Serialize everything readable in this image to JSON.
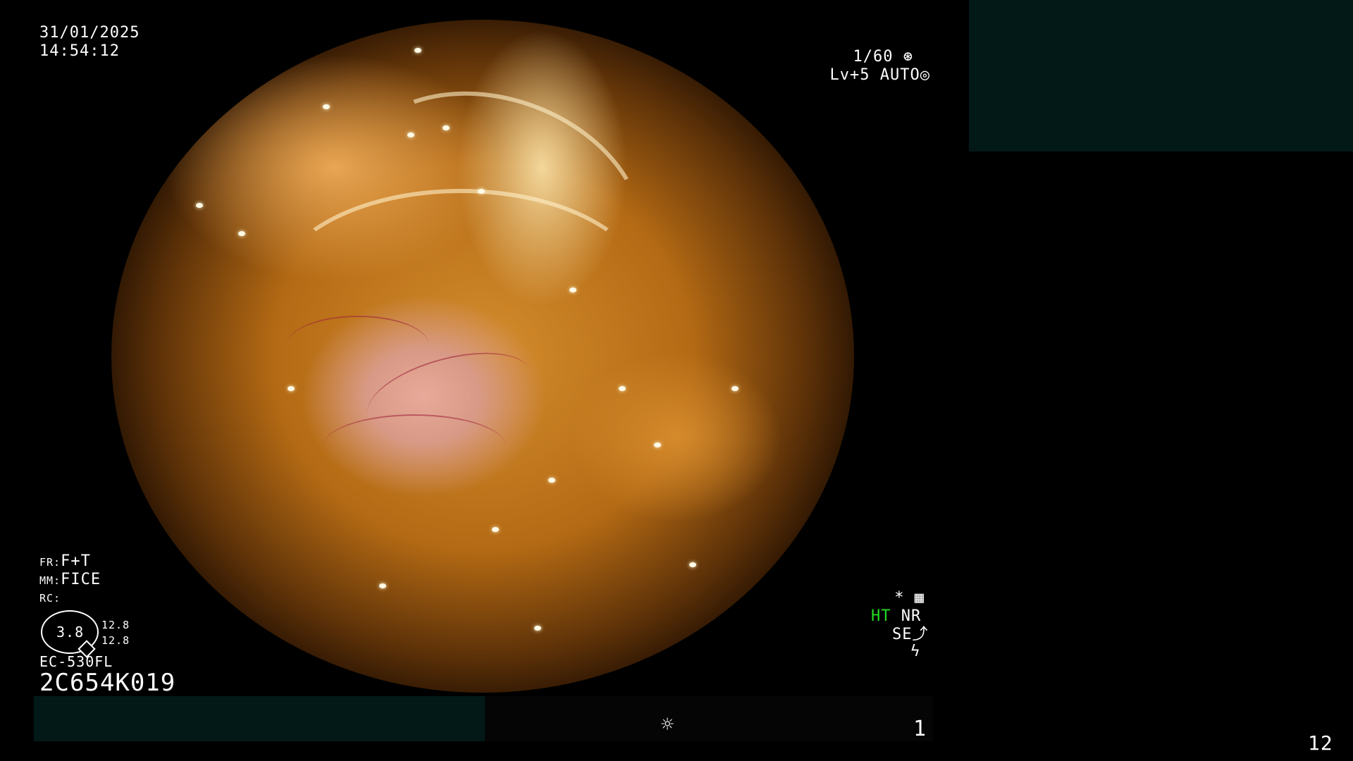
{
  "overlay": {
    "date": "31/01/2025",
    "time": "14:54:12",
    "shutter": "1/60",
    "level": "Lv+5",
    "exposure_mode": "AUTO",
    "fr_label": "FR:",
    "fr_value": "F+T",
    "mm_label": "MM:",
    "mm_value": "FICE",
    "rc_label": "RC:",
    "dial_value": "3.8",
    "dial_right_top": "12.8",
    "dial_right_bottom": "12.8",
    "scope_model": "EC-530FL",
    "serial": "2C654K019",
    "right_status": {
      "star": "*",
      "ht": "HT",
      "nr": "NR",
      "se": "SE"
    },
    "bottom_center_icon": "sun-icon",
    "bottom_counter": "1",
    "page_number": "12"
  },
  "colors": {
    "ht_green": "#22dd22",
    "panel": "#021918"
  }
}
